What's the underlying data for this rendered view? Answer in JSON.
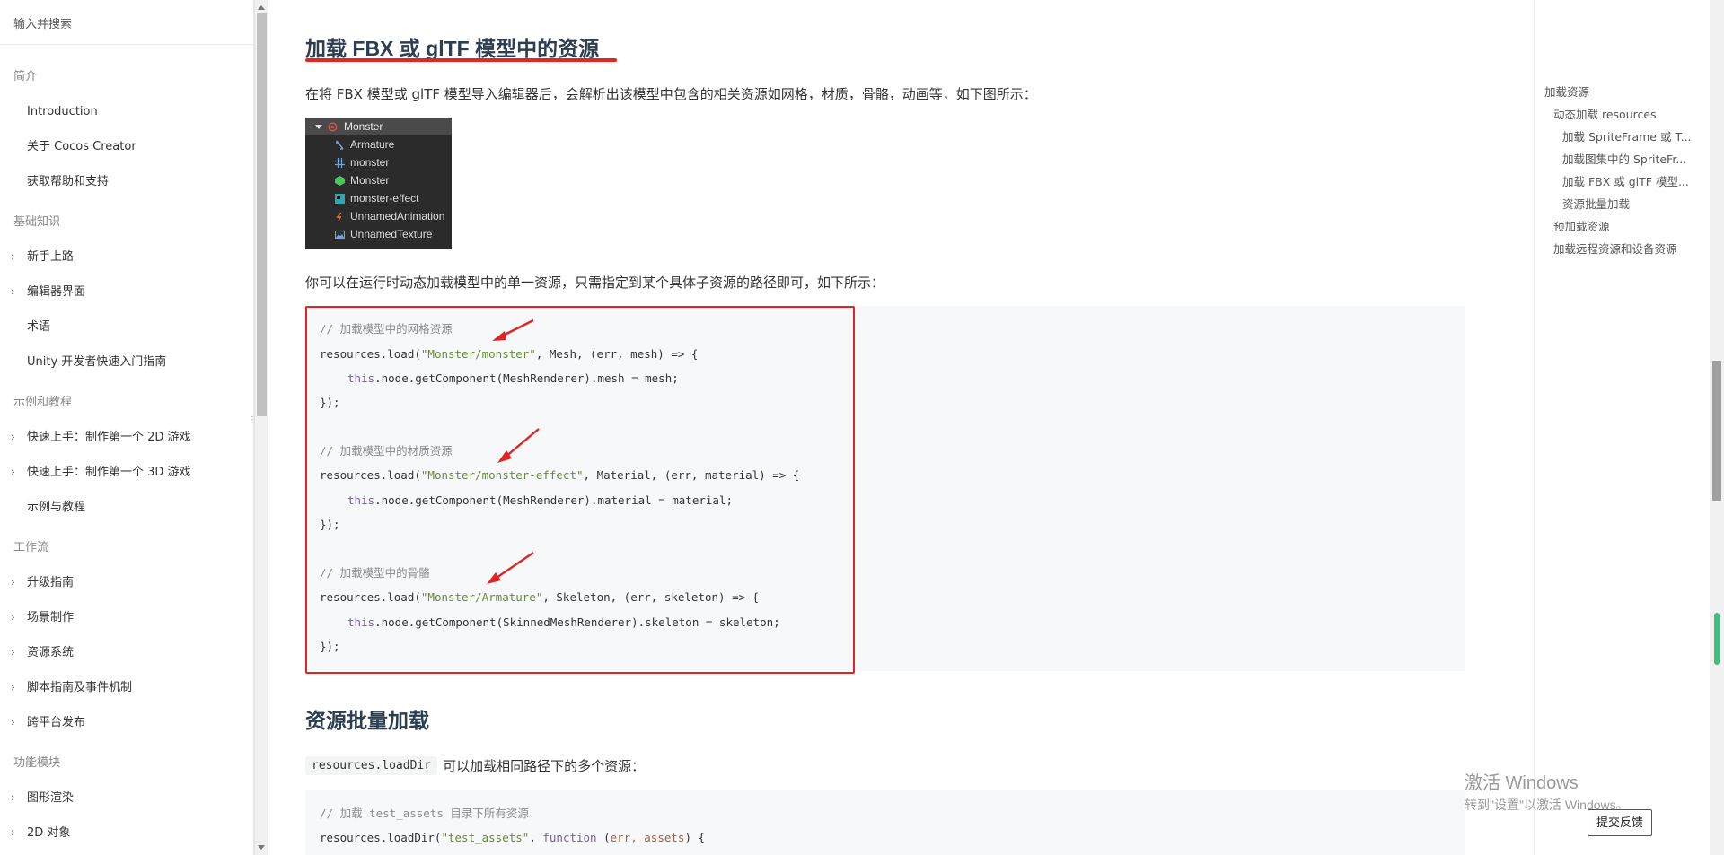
{
  "sidebar": {
    "search_placeholder": "输入并搜索",
    "sections": [
      {
        "title": "简介",
        "items": [
          {
            "label": "Introduction",
            "expandable": false
          },
          {
            "label": "关于 Cocos Creator",
            "expandable": false
          },
          {
            "label": "获取帮助和支持",
            "expandable": false
          }
        ]
      },
      {
        "title": "基础知识",
        "items": [
          {
            "label": "新手上路",
            "expandable": true
          },
          {
            "label": "编辑器界面",
            "expandable": true
          },
          {
            "label": "术语",
            "expandable": false
          },
          {
            "label": "Unity 开发者快速入门指南",
            "expandable": false
          }
        ]
      },
      {
        "title": "示例和教程",
        "items": [
          {
            "label": "快速上手：制作第一个 2D 游戏",
            "expandable": true
          },
          {
            "label": "快速上手：制作第一个 3D 游戏",
            "expandable": true
          },
          {
            "label": "示例与教程",
            "expandable": false
          }
        ]
      },
      {
        "title": "工作流",
        "items": [
          {
            "label": "升级指南",
            "expandable": true
          },
          {
            "label": "场景制作",
            "expandable": true
          },
          {
            "label": "资源系统",
            "expandable": true
          },
          {
            "label": "脚本指南及事件机制",
            "expandable": true
          },
          {
            "label": "跨平台发布",
            "expandable": true
          }
        ]
      },
      {
        "title": "功能模块",
        "items": [
          {
            "label": "图形渲染",
            "expandable": true
          },
          {
            "label": "2D 对象",
            "expandable": true
          }
        ]
      }
    ]
  },
  "article": {
    "heading_fbx": "加载 FBX 或 glTF 模型中的资源",
    "intro_text": "在将 FBX 模型或 glTF 模型导入编辑器后，会解析出该模型中包含的相关资源如网格，材质，骨骼，动画等，如下图所示：",
    "tree": [
      {
        "label": "Monster",
        "icon": "prefab-icon",
        "root": true
      },
      {
        "label": "Armature",
        "icon": "skeleton-icon"
      },
      {
        "label": "monster",
        "icon": "mesh-icon"
      },
      {
        "label": "Monster",
        "icon": "material-icon"
      },
      {
        "label": "monster-effect",
        "icon": "effect-icon"
      },
      {
        "label": "UnnamedAnimation",
        "icon": "animation-icon"
      },
      {
        "label": "UnnamedTexture",
        "icon": "texture-icon"
      }
    ],
    "single_asset_text": "你可以在运行时动态加载模型中的单一资源，只需指定到某个具体子资源的路径即可，如下所示：",
    "code_a": {
      "c1": "// 加载模型中的网格资源",
      "l1a": "resources.load(",
      "l1s": "\"Monster/monster\"",
      "l1b": ", Mesh, (err, mesh) => {",
      "l2k": "this",
      "l2b": ".node.getComponent(MeshRenderer).mesh = mesh;",
      "close": "});",
      "c2": "// 加载模型中的材质资源",
      "l4a": "resources.load(",
      "l4s": "\"Monster/monster-effect\"",
      "l4b": ", Material, (err, material) => {",
      "l5b": ".node.getComponent(MeshRenderer).material = material;",
      "c3": "// 加载模型中的骨骼",
      "l7a": "resources.load(",
      "l7s": "\"Monster/Armature\"",
      "l7b": ", Skeleton, (err, skeleton) => {",
      "l8b": ".node.getComponent(SkinnedMeshRenderer).skeleton = skeleton;"
    },
    "heading_batch": "资源批量加载",
    "batch_code_inline": "resources.loadDir",
    "batch_text": "可以加载相同路径下的多个资源：",
    "code_b": {
      "c1": "// 加载 test_assets 目录下所有资源",
      "l1a": "resources.loadDir(",
      "l1s": "\"test_assets\"",
      "l1c": ", ",
      "l1k": "function",
      "l1d": " (",
      "l1p": "err, assets",
      "l1e": ") {"
    }
  },
  "toc": [
    {
      "label": "加载资源",
      "level": 1
    },
    {
      "label": "动态加载 resources",
      "level": 2
    },
    {
      "label": "加载 SpriteFrame 或 T...",
      "level": 3
    },
    {
      "label": "加载图集中的 SpriteFr...",
      "level": 3
    },
    {
      "label": "加载 FBX 或 glTF 模型...",
      "level": 3
    },
    {
      "label": "资源批量加载",
      "level": 3
    },
    {
      "label": "预加载资源",
      "level": 2
    },
    {
      "label": "加载远程资源和设备资源",
      "level": 2
    }
  ],
  "watermark": {
    "title": "激活 Windows",
    "subtitle": "转到\"设置\"以激活 Windows。"
  },
  "feedback_button": "提交反馈",
  "colors": {
    "highlight_red": "#e02424",
    "heading": "#2c3e50",
    "code_bg": "#f6f8fa",
    "string": "#6a8a35",
    "keyword": "#7a5ba8",
    "scroll_indicator": "#3cc07a"
  }
}
